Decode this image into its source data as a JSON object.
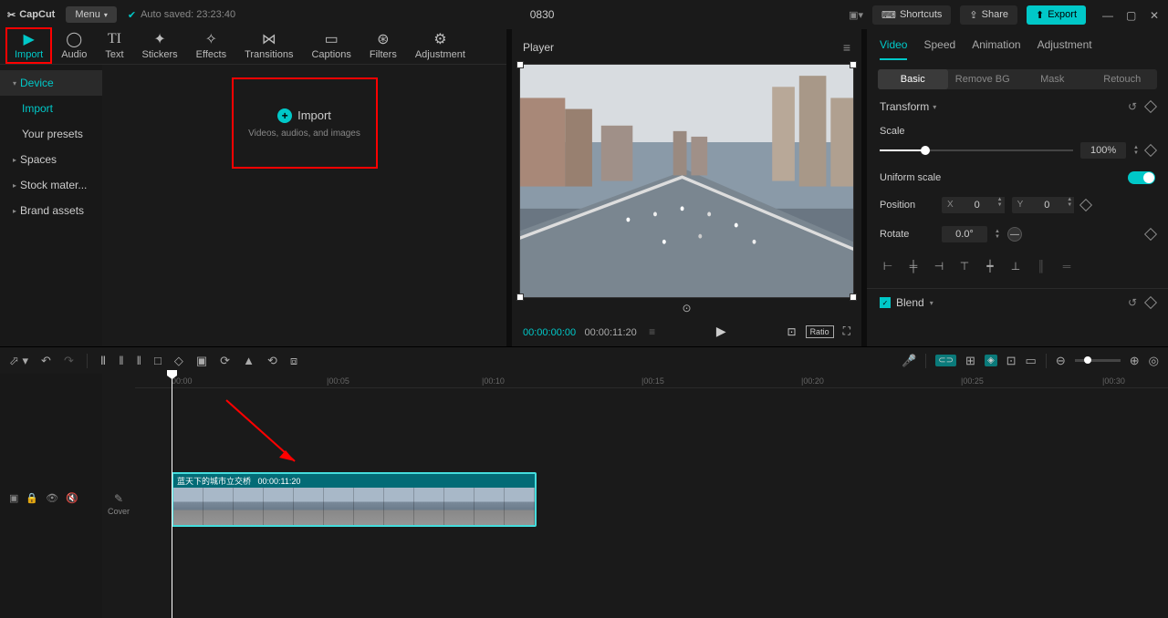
{
  "titlebar": {
    "app": "CapCut",
    "menu": "Menu",
    "autosave": "Auto saved: 23:23:40",
    "projectTitle": "0830",
    "shortcuts": "Shortcuts",
    "share": "Share",
    "export": "Export"
  },
  "topTabs": {
    "import": "Import",
    "audio": "Audio",
    "text": "Text",
    "stickers": "Stickers",
    "effects": "Effects",
    "transitions": "Transitions",
    "captions": "Captions",
    "filters": "Filters",
    "adjustment": "Adjustment"
  },
  "sidebar": {
    "device": "Device",
    "import": "Import",
    "presets": "Your presets",
    "spaces": "Spaces",
    "stock": "Stock mater...",
    "brand": "Brand assets"
  },
  "importBox": {
    "title": "Import",
    "subtitle": "Videos, audios, and images"
  },
  "player": {
    "title": "Player",
    "current": "00:00:00:00",
    "total": "00:00:11:20",
    "ratio": "Ratio"
  },
  "propTabs": {
    "video": "Video",
    "speed": "Speed",
    "animation": "Animation",
    "adjustment": "Adjustment"
  },
  "subTabs": {
    "basic": "Basic",
    "removebg": "Remove BG",
    "mask": "Mask",
    "retouch": "Retouch"
  },
  "transform": {
    "header": "Transform",
    "scale": "Scale",
    "scaleValue": "100%",
    "uniform": "Uniform scale",
    "position": "Position",
    "posX": "0",
    "posY": "0",
    "rotate": "Rotate",
    "rotateValue": "0.0°"
  },
  "blend": {
    "label": "Blend"
  },
  "timeline": {
    "cover": "Cover",
    "ticks": [
      "00:00",
      "|00:05",
      "|00:10",
      "|00:15",
      "|00:20",
      "|00:25",
      "|00:30"
    ],
    "clipName": "蓝天下的城市立交桥",
    "clipDuration": "00:00:11:20"
  }
}
